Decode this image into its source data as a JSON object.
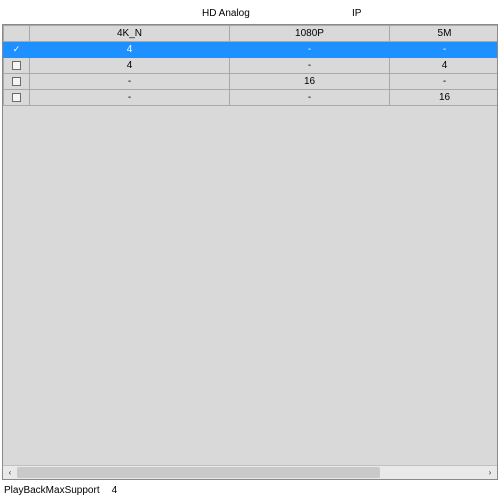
{
  "header": {
    "group_analog": "HD Analog",
    "group_ip": "IP"
  },
  "columns": {
    "col1": "4K_N",
    "col2": "1080P",
    "col3": "5M"
  },
  "rows": [
    {
      "selected": true,
      "c1": "4",
      "c2": "-",
      "c3": "-"
    },
    {
      "selected": false,
      "c1": "4",
      "c2": "-",
      "c3": "4"
    },
    {
      "selected": false,
      "c1": "-",
      "c2": "16",
      "c3": "-"
    },
    {
      "selected": false,
      "c1": "-",
      "c2": "-",
      "c3": "16"
    }
  ],
  "footer": {
    "label": "PlayBackMaxSupport",
    "value": "4"
  },
  "scroll": {
    "left_glyph": "‹",
    "right_glyph": "›"
  }
}
